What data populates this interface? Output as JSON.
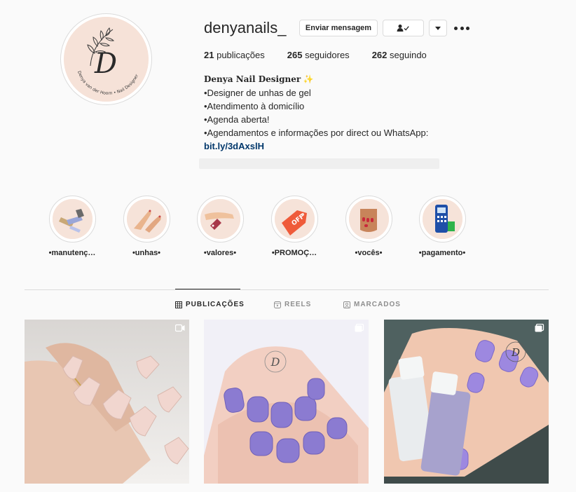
{
  "profile": {
    "username": "denyanails_",
    "avatar_text": "Denya van der Hoorn • Nail Designer",
    "avatar_letter": "D"
  },
  "header": {
    "message_button": "Enviar mensagem",
    "follow_icon": "person-check-icon",
    "dropdown_icon": "caret-down-icon",
    "more_icon": "more-dots-icon"
  },
  "stats": {
    "posts_count": "21",
    "posts_label": "publicações",
    "followers_count": "265",
    "followers_label": "seguidores",
    "following_count": "262",
    "following_label": "seguindo"
  },
  "bio": {
    "name": "Denya Nail Designer",
    "sparkle": "✨",
    "line1": "•Designer de unhas de gel",
    "line2": "•Atendimento à domicílio",
    "line3": "•Agenda aberta!",
    "line4": "•Agendamentos e informações por direct ou WhatsApp:",
    "link": "bit.ly/3dAxslH"
  },
  "highlights": [
    {
      "label": "•manutenç…",
      "icon": "nail-drill-icon"
    },
    {
      "label": "•unhas•",
      "icon": "hands-icon"
    },
    {
      "label": "•valores•",
      "icon": "price-tag-hand-icon"
    },
    {
      "label": "•PROMOÇ…",
      "icon": "discount-tag-icon"
    },
    {
      "label": "•vocês•",
      "icon": "fist-nails-icon"
    },
    {
      "label": "•pagamento•",
      "icon": "card-machine-icon"
    }
  ],
  "tabs": [
    {
      "label": "PUBLICAÇÕES",
      "icon": "grid-icon",
      "active": true
    },
    {
      "label": "REELS",
      "icon": "reels-icon",
      "active": false
    },
    {
      "label": "MARCADOS",
      "icon": "tagged-icon",
      "active": false
    }
  ],
  "posts": [
    {
      "type": "video",
      "badge_icon": "video-icon",
      "description_icon": "nude-nails-photo"
    },
    {
      "type": "carousel",
      "badge_icon": "carousel-icon",
      "description_icon": "purple-nails-photo"
    },
    {
      "type": "carousel",
      "badge_icon": "carousel-icon",
      "description_icon": "purple-nails-polish-photo"
    }
  ],
  "colors": {
    "link": "#00376b",
    "text": "#262626",
    "muted": "#8e8e8e",
    "border": "#dbdbdb",
    "background": "#fafafa",
    "avatar_bg": "#f6e2d8",
    "lilac": "#8f7fd6"
  }
}
